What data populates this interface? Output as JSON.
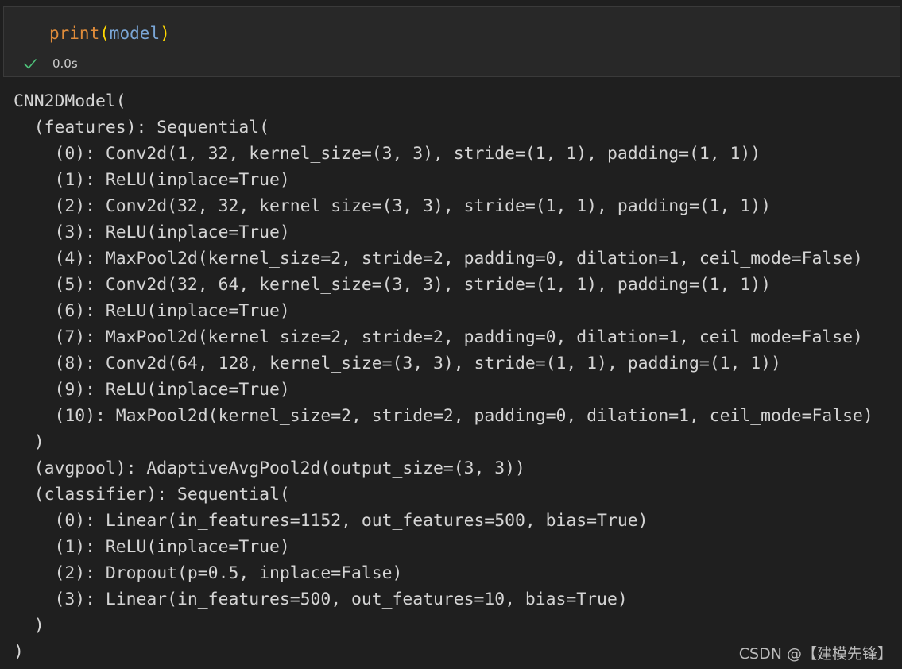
{
  "code_cell": {
    "function_name": "print",
    "open_paren": "(",
    "argument": "model",
    "close_paren": ")",
    "status_icon": "check-icon",
    "exec_time": "0.0s",
    "check_color": "#4ec27a"
  },
  "output": {
    "lines": [
      "CNN2DModel(",
      "  (features): Sequential(",
      "    (0): Conv2d(1, 32, kernel_size=(3, 3), stride=(1, 1), padding=(1, 1))",
      "    (1): ReLU(inplace=True)",
      "    (2): Conv2d(32, 32, kernel_size=(3, 3), stride=(1, 1), padding=(1, 1))",
      "    (3): ReLU(inplace=True)",
      "    (4): MaxPool2d(kernel_size=2, stride=2, padding=0, dilation=1, ceil_mode=False)",
      "    (5): Conv2d(32, 64, kernel_size=(3, 3), stride=(1, 1), padding=(1, 1))",
      "    (6): ReLU(inplace=True)",
      "    (7): MaxPool2d(kernel_size=2, stride=2, padding=0, dilation=1, ceil_mode=False)",
      "    (8): Conv2d(64, 128, kernel_size=(3, 3), stride=(1, 1), padding=(1, 1))",
      "    (9): ReLU(inplace=True)",
      "    (10): MaxPool2d(kernel_size=2, stride=2, padding=0, dilation=1, ceil_mode=False)",
      "  )",
      "  (avgpool): AdaptiveAvgPool2d(output_size=(3, 3))",
      "  (classifier): Sequential(",
      "    (0): Linear(in_features=1152, out_features=500, bias=True)",
      "    (1): ReLU(inplace=True)",
      "    (2): Dropout(p=0.5, inplace=False)",
      "    (3): Linear(in_features=500, out_features=10, bias=True)",
      "  )",
      ")"
    ]
  },
  "watermark": "CSDN @【建模先锋】"
}
